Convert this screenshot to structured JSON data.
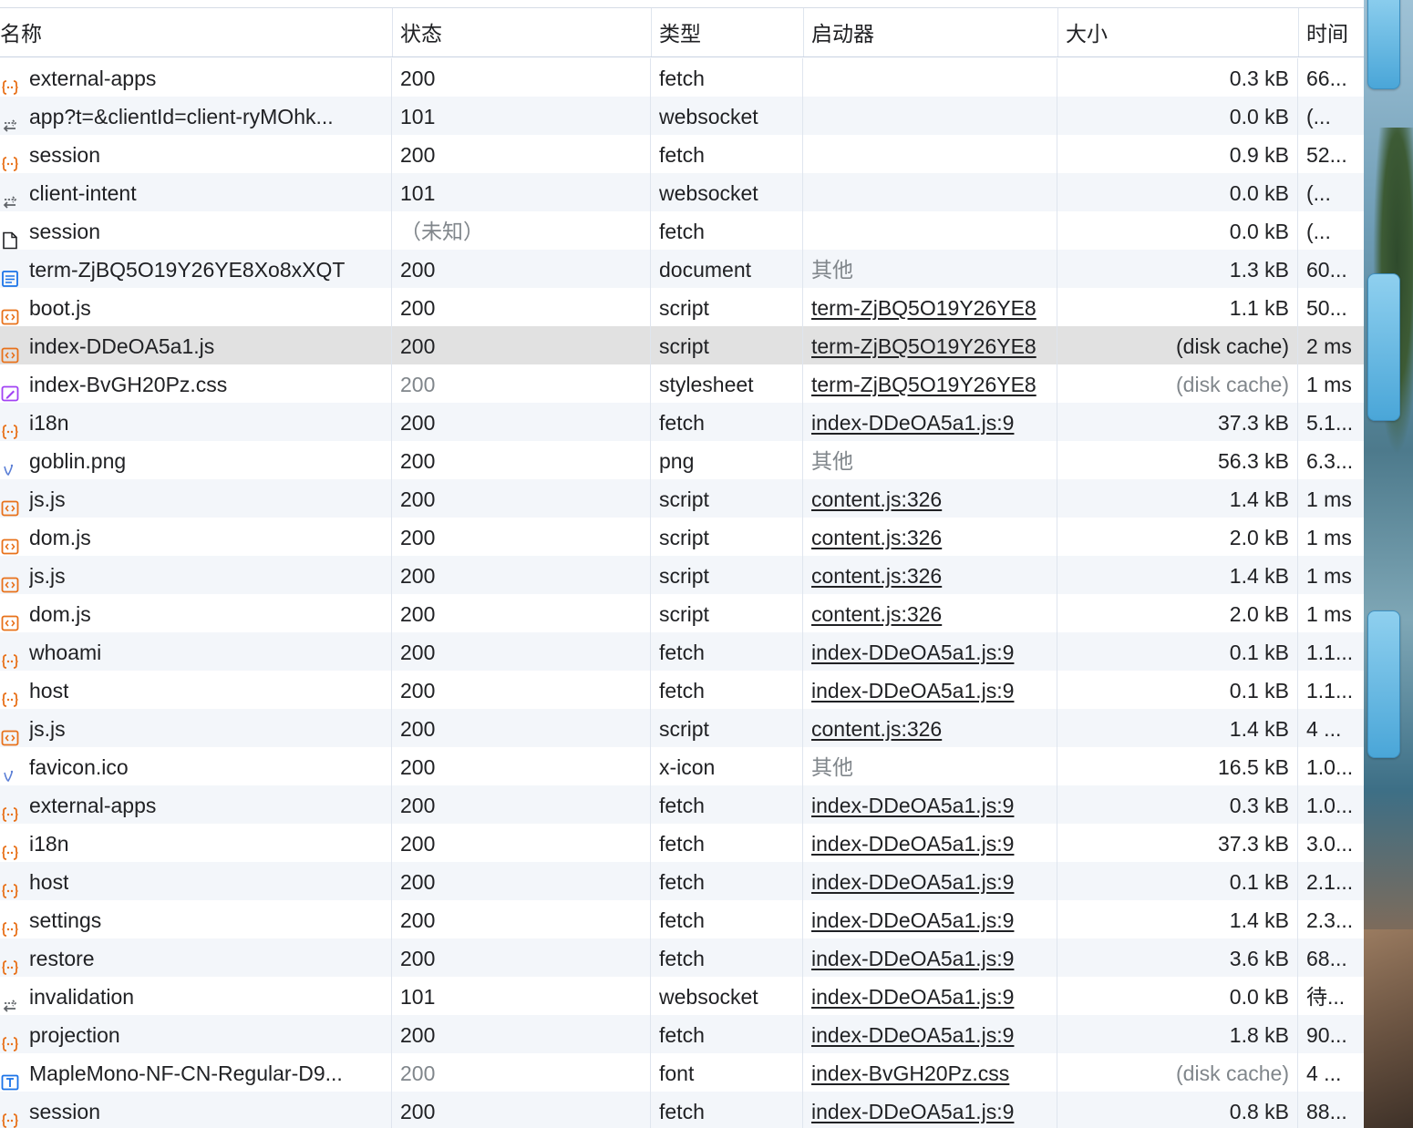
{
  "columns": {
    "name": "名称",
    "status": "状态",
    "type": "类型",
    "initiator": "启动器",
    "size": "大小",
    "time": "时间"
  },
  "colors": {
    "fetch_icon": "#e8711a",
    "script_icon": "#e8711a",
    "websocket_icon": "#5f6368",
    "document_icon": "#1a73e8",
    "stylesheet_icon": "#a142f4",
    "image_icon": "#1a73e8",
    "font_icon": "#1a73e8",
    "selected_row": "#e1e1e1",
    "alt_row": "#f3f6fa"
  },
  "rows": [
    {
      "icon": "fetch-icon",
      "name": "external-apps",
      "status": "200",
      "type": "fetch",
      "initiator": "",
      "size": "0.3 kB",
      "time": "66..."
    },
    {
      "icon": "websocket-icon",
      "name": "app?t=&clientId=client-ryMOhk...",
      "status": "101",
      "type": "websocket",
      "initiator": "",
      "size": "0.0 kB",
      "time": "(..."
    },
    {
      "icon": "fetch-icon",
      "name": "session",
      "status": "200",
      "type": "fetch",
      "initiator": "",
      "size": "0.9 kB",
      "time": "52..."
    },
    {
      "icon": "websocket-icon",
      "name": "client-intent",
      "status": "101",
      "type": "websocket",
      "initiator": "",
      "size": "0.0 kB",
      "time": "(..."
    },
    {
      "icon": "blank-file-icon",
      "name": "session",
      "status": "（未知）",
      "status_muted": true,
      "type": "fetch",
      "initiator": "",
      "size": "0.0 kB",
      "time": "(..."
    },
    {
      "icon": "document-icon",
      "name": "term-ZjBQ5O19Y26YE8Xo8xXQT",
      "status": "200",
      "type": "document",
      "initiator": "其他",
      "initiator_muted": true,
      "size": "1.3 kB",
      "time": "60..."
    },
    {
      "icon": "script-icon",
      "name": "boot.js",
      "status": "200",
      "type": "script",
      "initiator": "term-ZjBQ5O19Y26YE8",
      "initiator_link": true,
      "size": "1.1 kB",
      "time": "50..."
    },
    {
      "icon": "script-icon",
      "name": "index-DDeOA5a1.js",
      "status": "200",
      "type": "script",
      "initiator": "term-ZjBQ5O19Y26YE8",
      "initiator_link": true,
      "size": "(disk cache)",
      "time": "2 ms",
      "selected": true
    },
    {
      "icon": "stylesheet-icon",
      "name": "index-BvGH20Pz.css",
      "status": "200",
      "status_muted": true,
      "type": "stylesheet",
      "initiator": "term-ZjBQ5O19Y26YE8",
      "initiator_link": true,
      "size": "(disk cache)",
      "size_muted": true,
      "time": "1 ms"
    },
    {
      "icon": "fetch-icon",
      "name": "i18n",
      "status": "200",
      "type": "fetch",
      "initiator": "index-DDeOA5a1.js:9",
      "initiator_link": true,
      "size": "37.3 kB",
      "time": "5.1..."
    },
    {
      "icon": "image-icon",
      "name": "goblin.png",
      "status": "200",
      "type": "png",
      "initiator": "其他",
      "initiator_muted": true,
      "size": "56.3 kB",
      "time": "6.3..."
    },
    {
      "icon": "script-icon",
      "name": "js.js",
      "status": "200",
      "type": "script",
      "initiator": "content.js:326",
      "initiator_link": true,
      "size": "1.4 kB",
      "time": "1 ms"
    },
    {
      "icon": "script-icon",
      "name": "dom.js",
      "status": "200",
      "type": "script",
      "initiator": "content.js:326",
      "initiator_link": true,
      "size": "2.0 kB",
      "time": "1 ms"
    },
    {
      "icon": "script-icon",
      "name": "js.js",
      "status": "200",
      "type": "script",
      "initiator": "content.js:326",
      "initiator_link": true,
      "size": "1.4 kB",
      "time": "1 ms"
    },
    {
      "icon": "script-icon",
      "name": "dom.js",
      "status": "200",
      "type": "script",
      "initiator": "content.js:326",
      "initiator_link": true,
      "size": "2.0 kB",
      "time": "1 ms"
    },
    {
      "icon": "fetch-icon",
      "name": "whoami",
      "status": "200",
      "type": "fetch",
      "initiator": "index-DDeOA5a1.js:9",
      "initiator_link": true,
      "size": "0.1 kB",
      "time": "1.1..."
    },
    {
      "icon": "fetch-icon",
      "name": "host",
      "status": "200",
      "type": "fetch",
      "initiator": "index-DDeOA5a1.js:9",
      "initiator_link": true,
      "size": "0.1 kB",
      "time": "1.1..."
    },
    {
      "icon": "script-icon",
      "name": "js.js",
      "status": "200",
      "type": "script",
      "initiator": "content.js:326",
      "initiator_link": true,
      "size": "1.4 kB",
      "time": "4 ..."
    },
    {
      "icon": "image-icon",
      "name": "favicon.ico",
      "status": "200",
      "type": "x-icon",
      "initiator": "其他",
      "initiator_muted": true,
      "size": "16.5 kB",
      "time": "1.0..."
    },
    {
      "icon": "fetch-icon",
      "name": "external-apps",
      "status": "200",
      "type": "fetch",
      "initiator": "index-DDeOA5a1.js:9",
      "initiator_link": true,
      "size": "0.3 kB",
      "time": "1.0..."
    },
    {
      "icon": "fetch-icon",
      "name": "i18n",
      "status": "200",
      "type": "fetch",
      "initiator": "index-DDeOA5a1.js:9",
      "initiator_link": true,
      "size": "37.3 kB",
      "time": "3.0..."
    },
    {
      "icon": "fetch-icon",
      "name": "host",
      "status": "200",
      "type": "fetch",
      "initiator": "index-DDeOA5a1.js:9",
      "initiator_link": true,
      "size": "0.1 kB",
      "time": "2.1..."
    },
    {
      "icon": "fetch-icon",
      "name": "settings",
      "status": "200",
      "type": "fetch",
      "initiator": "index-DDeOA5a1.js:9",
      "initiator_link": true,
      "size": "1.4 kB",
      "time": "2.3..."
    },
    {
      "icon": "fetch-icon",
      "name": "restore",
      "status": "200",
      "type": "fetch",
      "initiator": "index-DDeOA5a1.js:9",
      "initiator_link": true,
      "size": "3.6 kB",
      "time": "68..."
    },
    {
      "icon": "websocket-icon",
      "name": "invalidation",
      "status": "101",
      "type": "websocket",
      "initiator": "index-DDeOA5a1.js:9",
      "initiator_link": true,
      "size": "0.0 kB",
      "time": "待..."
    },
    {
      "icon": "fetch-icon",
      "name": "projection",
      "status": "200",
      "type": "fetch",
      "initiator": "index-DDeOA5a1.js:9",
      "initiator_link": true,
      "size": "1.8 kB",
      "time": "90..."
    },
    {
      "icon": "font-icon",
      "name": "MapleMono-NF-CN-Regular-D9...",
      "status": "200",
      "status_muted": true,
      "type": "font",
      "initiator": "index-BvGH20Pz.css",
      "initiator_link": true,
      "size": "(disk cache)",
      "size_muted": true,
      "time": "4 ..."
    },
    {
      "icon": "fetch-icon",
      "name": "session",
      "status": "200",
      "type": "fetch",
      "initiator": "index-DDeOA5a1.js:9",
      "initiator_link": true,
      "size": "0.8 kB",
      "time": "88..."
    }
  ]
}
